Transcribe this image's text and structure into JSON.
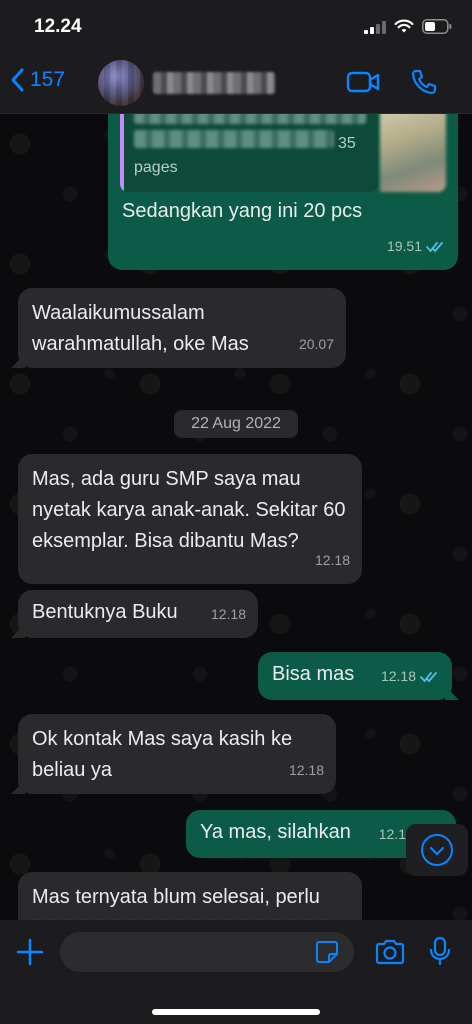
{
  "status_bar": {
    "time": "12.24"
  },
  "header": {
    "back_count": "157"
  },
  "date_separator": "22 Aug 2022",
  "messages": [
    {
      "side": "out",
      "doc_page_count": "35",
      "doc_pages_label": "pages",
      "text": "Sedangkan yang ini 20 pcs",
      "time": "19.51",
      "read": true
    },
    {
      "side": "in",
      "text": "Waalaikumussalam warahmatullah, oke Mas",
      "time": "20.07"
    },
    {
      "side": "in",
      "text": "Mas, ada guru SMP saya mau nyetak karya anak-anak. Sekitar 60 eksemplar. Bisa dibantu Mas?",
      "time": "12.18"
    },
    {
      "side": "in",
      "text": "Bentuknya Buku",
      "time": "12.18"
    },
    {
      "side": "out",
      "text": "Bisa mas",
      "time": "12.18",
      "read": true
    },
    {
      "side": "in",
      "text": "Ok kontak Mas saya kasih ke beliau ya",
      "time": "12.18"
    },
    {
      "side": "out",
      "text": "Ya mas, silahkan",
      "time": "12.1",
      "read": true
    },
    {
      "side": "in",
      "text": "Mas ternyata blum selesai, perlu",
      "time": ""
    }
  ],
  "composer": {
    "placeholder": ""
  },
  "colors": {
    "accent": "#0a84ff",
    "outgoing": "#0b5b46",
    "incoming": "#2a2a2c",
    "read_tick": "#53bdeb"
  },
  "icons": [
    "chevron-left-icon",
    "video-camera-icon",
    "phone-icon",
    "plus-icon",
    "sticker-icon",
    "camera-icon",
    "microphone-icon",
    "chevron-down-icon",
    "double-check-icon"
  ]
}
